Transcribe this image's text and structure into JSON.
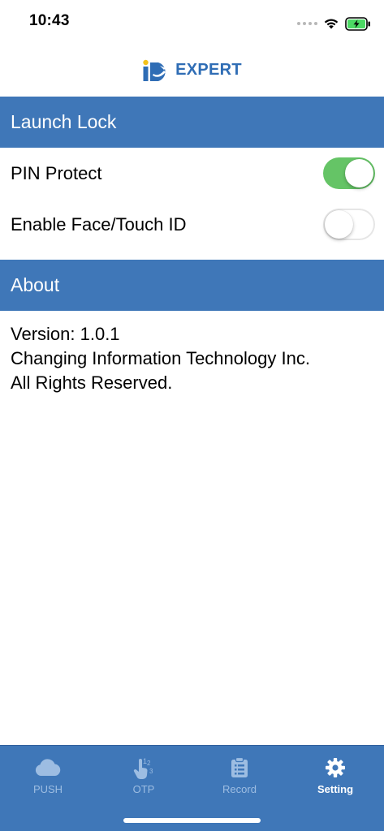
{
  "status_bar": {
    "time": "10:43",
    "icons": [
      "signal-dots-icon",
      "wifi-icon",
      "battery-charging-icon"
    ],
    "battery_color": "#4cd964"
  },
  "header": {
    "logo_mark": "iD",
    "logo_text": "EXPERT",
    "brand_color": "#2f6db5"
  },
  "sections": {
    "launch_lock": {
      "title": "Launch Lock",
      "rows": [
        {
          "label": "PIN Protect",
          "toggle_on": true
        },
        {
          "label": "Enable Face/Touch ID",
          "toggle_on": false
        }
      ]
    },
    "about": {
      "title": "About",
      "lines": [
        "Version: 1.0.1",
        "Changing Information Technology Inc.",
        "All Rights Reserved."
      ]
    }
  },
  "tab_bar": {
    "background": "#3f77b8",
    "tabs": [
      {
        "label": "PUSH",
        "icon": "cloud-icon",
        "active": false
      },
      {
        "label": "OTP",
        "icon": "hand-123-icon",
        "active": false
      },
      {
        "label": "Record",
        "icon": "clipboard-list-icon",
        "active": false
      },
      {
        "label": "Setting",
        "icon": "gear-icon",
        "active": true
      }
    ]
  },
  "colors": {
    "section_header": "#3f77b8",
    "toggle_on": "#65c466",
    "tab_inactive": "#9dbde2",
    "tab_active": "#ffffff"
  }
}
